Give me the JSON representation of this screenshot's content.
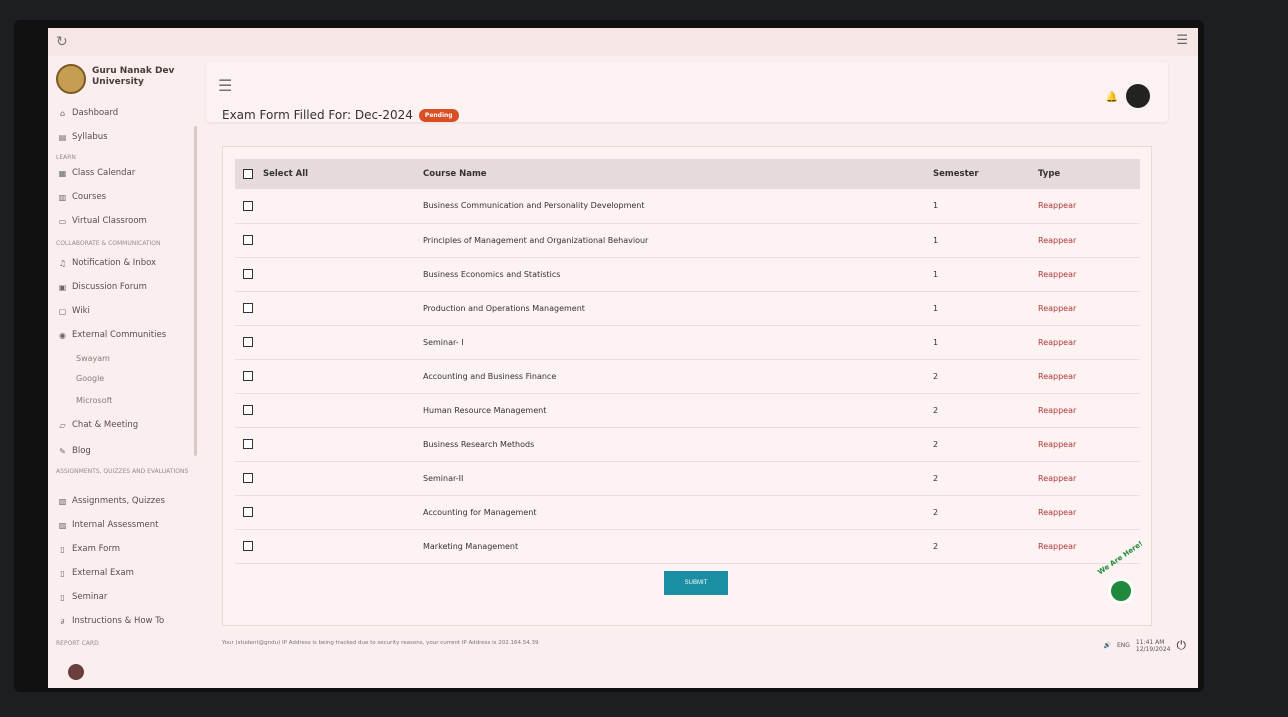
{
  "university": "Guru Nanak Dev University",
  "sidebar": {
    "items": [
      {
        "icon": "home-icon",
        "label": "Dashboard"
      },
      {
        "icon": "file-icon",
        "label": "Syllabus"
      },
      {
        "section": "LEARN"
      },
      {
        "icon": "calendar-icon",
        "label": "Class Calendar"
      },
      {
        "icon": "book-icon",
        "label": "Courses"
      },
      {
        "icon": "monitor-icon",
        "label": "Virtual Classroom"
      },
      {
        "section": "COLLABORATE & COMMUNICATION"
      },
      {
        "icon": "bell-icon",
        "label": "Notification & Inbox"
      },
      {
        "icon": "forum-icon",
        "label": "Discussion Forum"
      },
      {
        "icon": "wiki-icon",
        "label": "Wiki"
      },
      {
        "icon": "globe-icon",
        "label": "External Communities"
      },
      {
        "sub": "Swayam"
      },
      {
        "sub": "Google"
      },
      {
        "sub": "Microsoft"
      },
      {
        "icon": "chat-icon",
        "label": "Chat & Meeting"
      },
      {
        "icon": "blog-icon",
        "label": "Blog"
      },
      {
        "section": "ASSIGNMENTS, QUIZZES AND EVALUATIONS"
      },
      {
        "icon": "assignment-icon",
        "label": "Assignments, Quizzes"
      },
      {
        "icon": "assessment-icon",
        "label": "Internal Assessment"
      },
      {
        "icon": "document-icon",
        "label": "Exam Form"
      },
      {
        "icon": "document-icon",
        "label": "External Exam"
      },
      {
        "icon": "document-icon",
        "label": "Seminar"
      },
      {
        "icon": "link-icon",
        "label": "Instructions & How To"
      },
      {
        "section": "REPORT CARD"
      }
    ]
  },
  "header": {
    "title": "Exam Form Filled For: Dec-2024",
    "status": "Pending"
  },
  "table": {
    "select_all": "Select All",
    "columns": {
      "course": "Course Name",
      "semester": "Semester",
      "type": "Type"
    },
    "rows": [
      {
        "course": "Business Communication and Personality Development",
        "semester": "1",
        "type": "Reappear"
      },
      {
        "course": "Principles of Management and Organizational Behaviour",
        "semester": "1",
        "type": "Reappear"
      },
      {
        "course": "Business Economics and Statistics",
        "semester": "1",
        "type": "Reappear"
      },
      {
        "course": "Production and Operations Management",
        "semester": "1",
        "type": "Reappear"
      },
      {
        "course": "Seminar- I",
        "semester": "1",
        "type": "Reappear"
      },
      {
        "course": "Accounting and Business Finance",
        "semester": "2",
        "type": "Reappear"
      },
      {
        "course": "Human Resource Management",
        "semester": "2",
        "type": "Reappear"
      },
      {
        "course": "Business Research Methods",
        "semester": "2",
        "type": "Reappear"
      },
      {
        "course": "Seminar-II",
        "semester": "2",
        "type": "Reappear"
      },
      {
        "course": "Accounting for Management",
        "semester": "2",
        "type": "Reappear"
      },
      {
        "course": "Marketing Management",
        "semester": "2",
        "type": "Reappear"
      }
    ]
  },
  "submit_label": "SUBMIT",
  "footer": {
    "ip_notice": "Your (student@gndu) IP Address is being tracked due to security reasons, your current IP Address is 202.164.54.39"
  },
  "tray": {
    "lang": "ENG",
    "time": "11:41 AM",
    "date": "12/19/2024"
  },
  "help_label": "We Are Here!",
  "colors": {
    "accent": "#1a8fa3",
    "badge": "#d94e22",
    "type_text": "#b23535"
  }
}
